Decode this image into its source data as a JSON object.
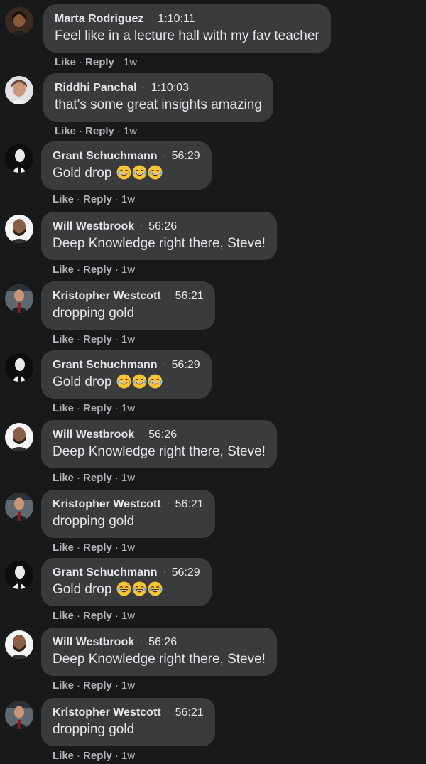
{
  "comments": [
    {
      "name": "Marta Rodriguez",
      "time": "1:10:11",
      "text": "Feel like in a lecture hall with my fav teacher",
      "emojis": 0,
      "avatar": "woman-dark-hair",
      "like": "Like",
      "reply": "Reply",
      "age": "1w"
    },
    {
      "name": "Riddhi Panchal",
      "time": "1:10:03",
      "text": "that's some great insights amazing",
      "emojis": 0,
      "avatar": "woman-light",
      "like": "Like",
      "reply": "Reply",
      "age": "1w"
    },
    {
      "name": "Grant Schuchmann",
      "time": "56:29",
      "text": "Gold drop",
      "emojis": 3,
      "avatar": "man-black-white",
      "like": "Like",
      "reply": "Reply",
      "age": "1w"
    },
    {
      "name": "Will Westbrook",
      "time": "56:26",
      "text": "Deep Knowledge right there, Steve!",
      "emojis": 0,
      "avatar": "man-beard-white-bg",
      "like": "Like",
      "reply": "Reply",
      "age": "1w"
    },
    {
      "name": "Kristopher Westcott",
      "time": "56:21",
      "text": "dropping gold",
      "emojis": 0,
      "avatar": "man-suit",
      "like": "Like",
      "reply": "Reply",
      "age": "1w"
    },
    {
      "name": "Grant Schuchmann",
      "time": "56:29",
      "text": "Gold drop",
      "emojis": 3,
      "avatar": "man-black-white",
      "like": "Like",
      "reply": "Reply",
      "age": "1w"
    },
    {
      "name": "Will Westbrook",
      "time": "56:26",
      "text": "Deep Knowledge right there, Steve!",
      "emojis": 0,
      "avatar": "man-beard-white-bg",
      "like": "Like",
      "reply": "Reply",
      "age": "1w"
    },
    {
      "name": "Kristopher Westcott",
      "time": "56:21",
      "text": "dropping gold",
      "emojis": 0,
      "avatar": "man-suit",
      "like": "Like",
      "reply": "Reply",
      "age": "1w"
    },
    {
      "name": "Grant Schuchmann",
      "time": "56:29",
      "text": "Gold drop",
      "emojis": 3,
      "avatar": "man-black-white",
      "like": "Like",
      "reply": "Reply",
      "age": "1w"
    },
    {
      "name": "Will Westbrook",
      "time": "56:26",
      "text": "Deep Knowledge right there, Steve!",
      "emojis": 0,
      "avatar": "man-beard-white-bg",
      "like": "Like",
      "reply": "Reply",
      "age": "1w"
    },
    {
      "name": "Kristopher Westcott",
      "time": "56:21",
      "text": "dropping gold",
      "emojis": 0,
      "avatar": "man-suit",
      "like": "Like",
      "reply": "Reply",
      "age": "1w"
    }
  ],
  "emoji_icon": "face-with-tears-of-joy",
  "colors": {
    "background": "#18191a",
    "bubble": "#3a3b3c",
    "secondary_text": "#b0b3b8"
  }
}
